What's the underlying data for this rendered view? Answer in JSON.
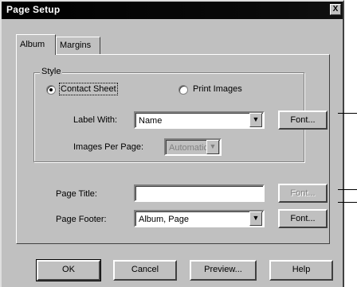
{
  "window": {
    "title": "Page Setup",
    "close_glyph": "X"
  },
  "tabs": [
    {
      "label": "Album",
      "active": true
    },
    {
      "label": "Margins",
      "active": false
    }
  ],
  "style_group": {
    "label": "Style",
    "options": [
      {
        "label": "Contact Sheet",
        "checked": true
      },
      {
        "label": "Print Images",
        "checked": false
      }
    ],
    "label_with": {
      "label": "Label With:",
      "value": "Name"
    },
    "images_per_page": {
      "label": "Images Per Page:",
      "value": "Automatic",
      "disabled": true
    },
    "font_button": "Font..."
  },
  "page_title": {
    "label": "Page Title:",
    "value": "",
    "font_button": "Font...",
    "font_disabled": true
  },
  "page_footer": {
    "label": "Page Footer:",
    "value": "Album, Page",
    "font_button": "Font..."
  },
  "buttons": {
    "ok": "OK",
    "cancel": "Cancel",
    "preview": "Preview...",
    "help": "Help"
  },
  "icons": {
    "dropdown": "dropdown-arrow-icon"
  },
  "glyphs": {
    "dropdown": "▼"
  }
}
